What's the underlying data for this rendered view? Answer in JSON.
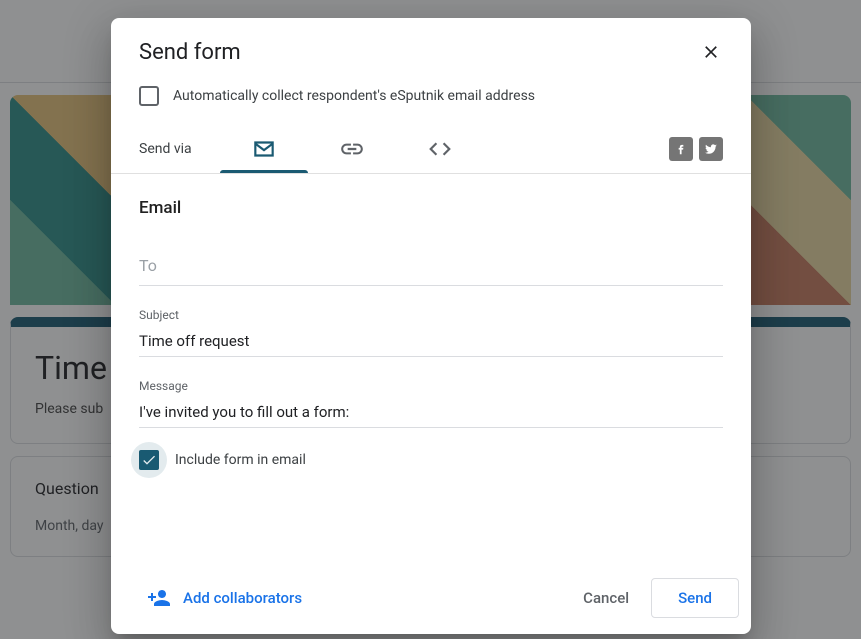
{
  "backdrop": {
    "title": "Time",
    "subtitle": "Please sub",
    "question_label": "Question",
    "answer_placeholder": "Month, day"
  },
  "dialog": {
    "title": "Send form",
    "auto_collect_label": "Automatically collect respondent's eSputnik email address",
    "send_via_label": "Send via",
    "section_title": "Email",
    "fields": {
      "to": {
        "placeholder": "To",
        "value": ""
      },
      "subject": {
        "label": "Subject",
        "value": "Time off request"
      },
      "message": {
        "label": "Message",
        "value": "I've invited you to fill out a form:"
      }
    },
    "include_label": "Include form in email",
    "add_collaborators_label": "Add collaborators",
    "cancel_label": "Cancel",
    "send_label": "Send"
  }
}
